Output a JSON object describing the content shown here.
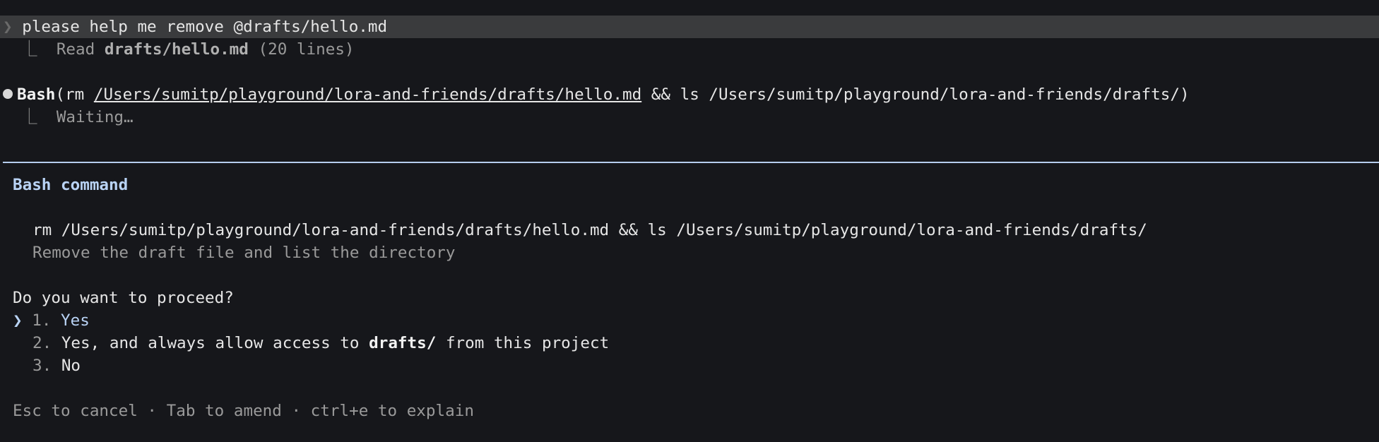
{
  "transcript": {
    "user_prompt_marker": "❯",
    "user_prompt": "please help me remove @drafts/hello.md",
    "read_result": {
      "connector": "⎿",
      "verb": "Read",
      "file": "drafts/hello.md",
      "detail": "(20 lines)"
    },
    "tool_call": {
      "tool": "Bash",
      "open": "(rm ",
      "path_link": "/Users/sumitp/playground/lora-and-friends/drafts/hello.md",
      "rest": " && ls /Users/sumitp/playground/lora-and-friends/drafts/)",
      "connector": "⎿",
      "status": "Waiting…"
    }
  },
  "dialog": {
    "title": "Bash command",
    "command": "rm /Users/sumitp/playground/lora-and-friends/drafts/hello.md && ls /Users/sumitp/playground/lora-and-friends/drafts/",
    "description": "Remove the draft file and list the directory",
    "question": "Do you want to proceed?",
    "selected_marker": "❯",
    "options": [
      {
        "number": "1.",
        "label": "Yes"
      },
      {
        "number": "2.",
        "label_before": "Yes, and always allow access to ",
        "label_bold": "drafts/",
        "label_after": " from this project"
      },
      {
        "number": "3.",
        "label": "No"
      }
    ],
    "hint": "Esc to cancel · Tab to amend · ctrl+e to explain"
  },
  "colors": {
    "background": "#16171b",
    "selection_row": "#3a3b3d",
    "accent_blue": "#b9d3f5",
    "dim_text": "#9a9a9a"
  }
}
